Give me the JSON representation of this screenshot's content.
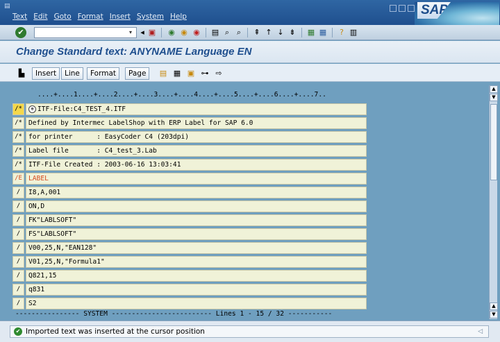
{
  "menu": [
    "Text",
    "Edit",
    "Goto",
    "Format",
    "Insert",
    "System",
    "Help"
  ],
  "logo_text": "SAP",
  "command_field": {
    "value": ""
  },
  "screen_title": "Change Standard text: ANYNAME Language EN",
  "app_toolbar": {
    "insert": "Insert",
    "line": "Line",
    "format": "Format",
    "page": "Page"
  },
  "editor": {
    "ruler": "....+....1....+....2....+....3....+....4....+....5....+....6....+....7..",
    "lines": [
      {
        "format": "/*",
        "text": "ITF-File:C4_TEST_4.ITF"
      },
      {
        "format": "/*",
        "text": "Defined by Intermec LabelShop with ERP Label for SAP 6.0"
      },
      {
        "format": "/*",
        "text": "for printer      : EasyCoder C4 (203dpi)"
      },
      {
        "format": "/*",
        "text": "Label file       : C4_test_3.Lab"
      },
      {
        "format": "/*",
        "text": "ITF-File Created : 2003-06-16 13:03:41"
      },
      {
        "format": "/E",
        "text": "LABEL"
      },
      {
        "format": "/",
        "text": "I8,A,001"
      },
      {
        "format": "/",
        "text": "ON,D"
      },
      {
        "format": "/",
        "text": "FK\"LABLSOFT\""
      },
      {
        "format": "/",
        "text": "FS\"LABLSOFT\""
      },
      {
        "format": "/",
        "text": "V00,25,N,\"EAN128\""
      },
      {
        "format": "/",
        "text": "V01,25,N,\"Formula1\""
      },
      {
        "format": "/",
        "text": "Q821,15"
      },
      {
        "format": "/",
        "text": "q831"
      },
      {
        "format": "/",
        "text": "S2"
      }
    ],
    "system_line": "---------------- SYSTEM ------------------------- Lines 1 - 15 / 32 -----------"
  },
  "status": {
    "message": "Imported text was inserted at the cursor position"
  },
  "colors": {
    "title_bar": "#1f4f8e",
    "editor_bg": "#6f9fbf",
    "line_bg": "#f0f2d8",
    "label_red": "#d64a1f",
    "highlight": "#f4d84a"
  }
}
